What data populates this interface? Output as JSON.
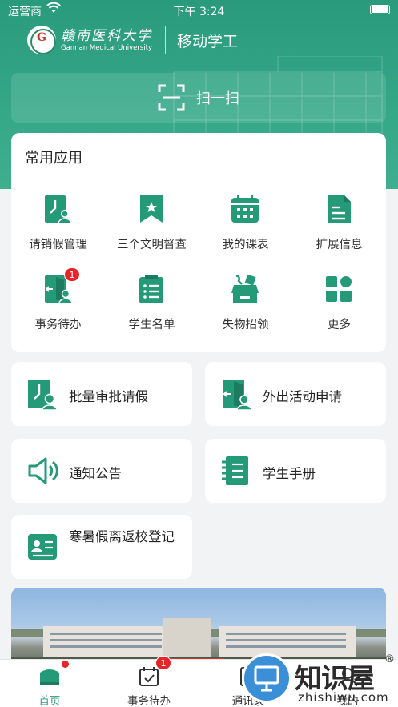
{
  "status_bar": {
    "carrier": "运营商",
    "time": "下午 3:24"
  },
  "header": {
    "school_cn": "赣南医科大学",
    "school_en": "Gannan Medical University",
    "app_name": "移动学工",
    "scan_label": "扫一扫",
    "accent_color": "#2a9a7c"
  },
  "common_apps": {
    "title": "常用应用",
    "items": [
      {
        "label": "请销假管理",
        "icon": "leave-request-icon"
      },
      {
        "label": "三个文明督查",
        "icon": "bookmark-star-icon"
      },
      {
        "label": "我的课表",
        "icon": "calendar-icon"
      },
      {
        "label": "扩展信息",
        "icon": "document-icon"
      },
      {
        "label": "事务待办",
        "icon": "door-exit-icon",
        "badge": "1"
      },
      {
        "label": "学生名单",
        "icon": "list-icon"
      },
      {
        "label": "失物招领",
        "icon": "lost-found-box-icon"
      },
      {
        "label": "更多",
        "icon": "grid-more-icon"
      }
    ]
  },
  "tiles": [
    {
      "label": "批量审批请假",
      "icon": "batch-approve-icon"
    },
    {
      "label": "外出活动申请",
      "icon": "outing-door-icon"
    },
    {
      "label": "通知公告",
      "icon": "speaker-icon"
    },
    {
      "label": "学生手册",
      "icon": "handbook-icon"
    },
    {
      "label": "寒暑假离返校登记",
      "icon": "id-card-icon"
    }
  ],
  "tabbar": {
    "items": [
      {
        "label": "首页",
        "icon": "home-icon",
        "active": true
      },
      {
        "label": "事务待办",
        "icon": "calendar-check-icon",
        "badge": "1"
      },
      {
        "label": "通讯录",
        "icon": "contacts-icon"
      },
      {
        "label": "我的",
        "icon": "profile-icon"
      }
    ]
  },
  "watermark": {
    "cn": "知识屋",
    "en": "zhishiwu.com",
    "mark": "®"
  }
}
